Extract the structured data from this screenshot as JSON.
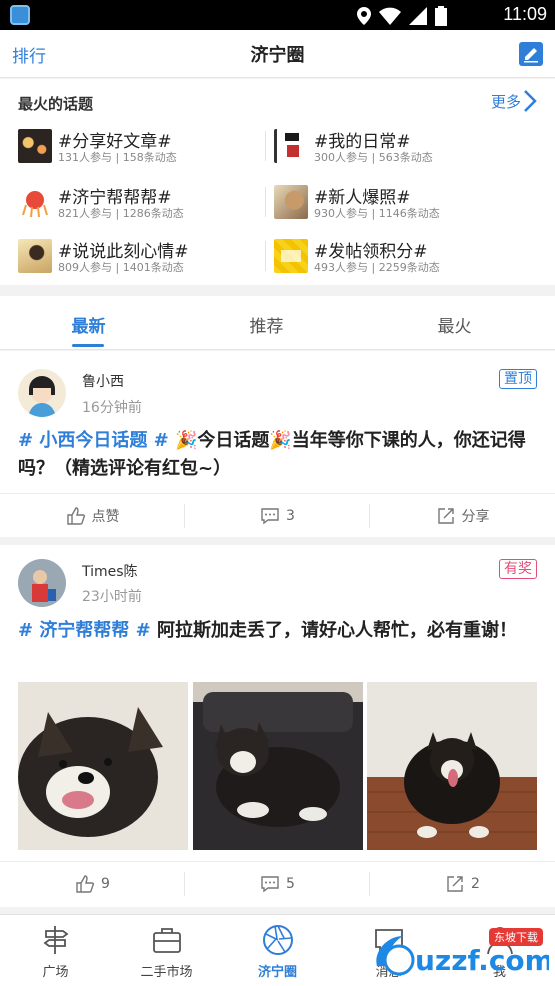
{
  "status_bar": {
    "time": "11:09"
  },
  "header": {
    "left": "排行",
    "title": "济宁圈"
  },
  "hot_topics": {
    "title": "最火的话题",
    "more": "更多",
    "items": [
      {
        "name": "#分享好文章#",
        "meta": "131人参与 | 158条动态"
      },
      {
        "name": "#我的日常#",
        "meta": "300人参与 | 563条动态"
      },
      {
        "name": "#济宁帮帮帮#",
        "meta": "821人参与 | 1286条动态"
      },
      {
        "name": "#新人爆照#",
        "meta": "930人参与 | 1146条动态"
      },
      {
        "name": "#说说此刻心情#",
        "meta": "809人参与 | 1401条动态"
      },
      {
        "name": "#发帖领积分#",
        "meta": "493人参与 | 2259条动态"
      }
    ]
  },
  "tabs": [
    "最新",
    "推荐",
    "最火"
  ],
  "posts": [
    {
      "author": "鲁小西",
      "time": "16分钟前",
      "badge": "置顶",
      "tag": "# 小西今日话题 #",
      "text": " 🎉今日话题🎉当年等你下课的人，你还记得吗？（精选评论有红包~）",
      "like": "点赞",
      "comments": "3",
      "share": "分享"
    },
    {
      "author": "Times陈",
      "time": "23小时前",
      "badge": "有奖",
      "tag": "# 济宁帮帮帮 #",
      "text": " 阿拉斯加走丢了，请好心人帮忙，必有重谢！",
      "like": "9",
      "comments": "5",
      "share": "2"
    }
  ],
  "bottom_nav": [
    "广场",
    "二手市场",
    "济宁圈",
    "消息",
    "我"
  ],
  "watermark": {
    "brand": "uzzf.com",
    "sub": "东坡下载"
  },
  "colors": {
    "accent": "#2f7fd8",
    "badge_top": "#2f7fd8",
    "badge_prize": "#e0507a"
  }
}
